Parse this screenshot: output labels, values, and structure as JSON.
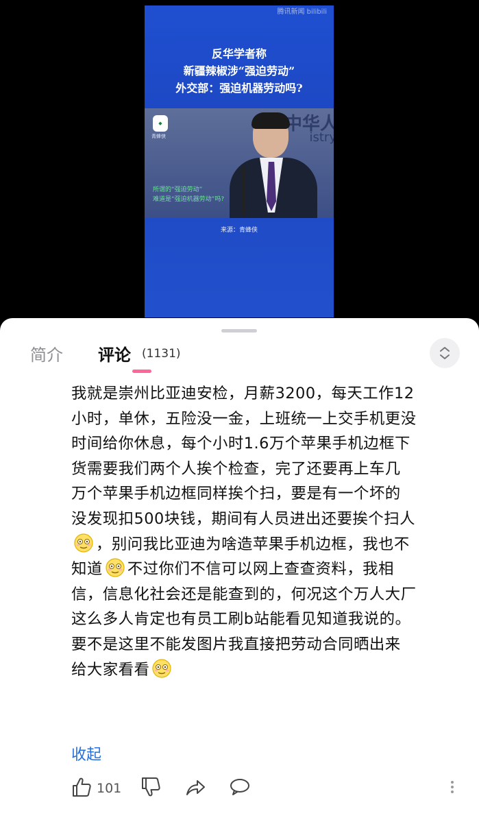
{
  "video": {
    "watermark": "腾讯新闻 bilibili",
    "headline": [
      "反华学者称",
      "新疆辣椒涉“强迫劳动”",
      "外交部：强迫机器劳动吗?"
    ],
    "badge_name": "青蜂侠",
    "sign_text": "中华人",
    "sign_text2": "istry",
    "caption": [
      "所谓的“强迫劳动”",
      "难道是“强迫机器劳动”吗?"
    ],
    "source": "来源：青蜂侠"
  },
  "tabs": {
    "intro": "简介",
    "comments": "评论",
    "comments_count": "(1131)"
  },
  "comment": {
    "line1": "我就是崇州比亚迪安检，月薪3200，每天工作12",
    "line2": "小时，单休，五险没一金，上班统一上交手机更没",
    "line3": "时间给你休息，每个小时1.6万个苹果手机边框下",
    "line4": "货需要我们两个人挨个检查，完了还要再上车几",
    "line5": "万个苹果手机边框同样挨个扫，要是有一个坏的",
    "line6": "没发现扣500块钱，期间有人员进出还要挨个扫人",
    "line7": "，别问我比亚迪为啥造苹果手机边框，我也不",
    "line8a": "知道",
    "line8b": "不过你们不信可以网上查查资料，我相",
    "line9": "信，信息化社会还是能查到的，何况这个万人大厂",
    "line10": "这么多人肯定也有员工刷b站能看见知道我说的。",
    "line11": "要不是这里不能发图片我直接把劳动合同晒出来",
    "line12": "给大家看看",
    "emoji_icon": "dizzy-face-emoji",
    "collapse": "收起"
  },
  "actions": {
    "like_count": "101",
    "like_icon": "thumbs-up-icon",
    "dislike_icon": "thumbs-down-icon",
    "share_icon": "share-icon",
    "reply_icon": "comment-icon",
    "more_icon": "more-vertical-icon"
  },
  "colors": {
    "accent": "#ff6699",
    "link": "#2a6fd8",
    "video_bg": "#1f4fd0"
  }
}
